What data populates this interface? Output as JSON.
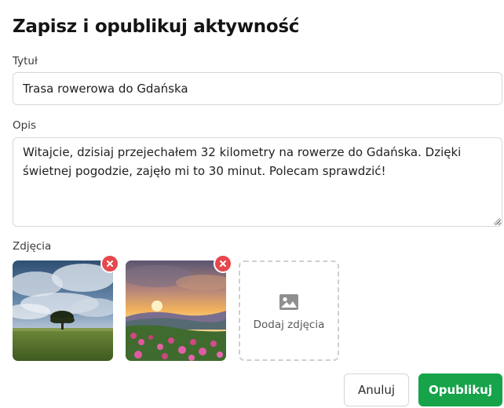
{
  "dialog": {
    "title": "Zapisz i opublikuj aktywność"
  },
  "form": {
    "title_label": "Tytuł",
    "title_value": "Trasa rowerowa do Gdańska",
    "description_label": "Opis",
    "description_value": "Witajcie, dzisiaj przejechałem 32 kilometry na rowerze do Gdańska. Dzięki świetnej pogodzie, zajęło mi to 30 minut. Polecam sprawdzić!",
    "photos_label": "Zdjęcia",
    "add_photos_label": "Dodaj zdjęcia"
  },
  "photos": [
    {
      "icon": "tree-meadow-photo",
      "remove_icon": "close-icon"
    },
    {
      "icon": "sunset-flowers-photo",
      "remove_icon": "close-icon"
    }
  ],
  "actions": {
    "cancel_label": "Anuluj",
    "publish_label": "Opublikuj"
  },
  "colors": {
    "primary": "#16a34a",
    "remove": "#e5484d",
    "border": "#d6d6d6"
  }
}
